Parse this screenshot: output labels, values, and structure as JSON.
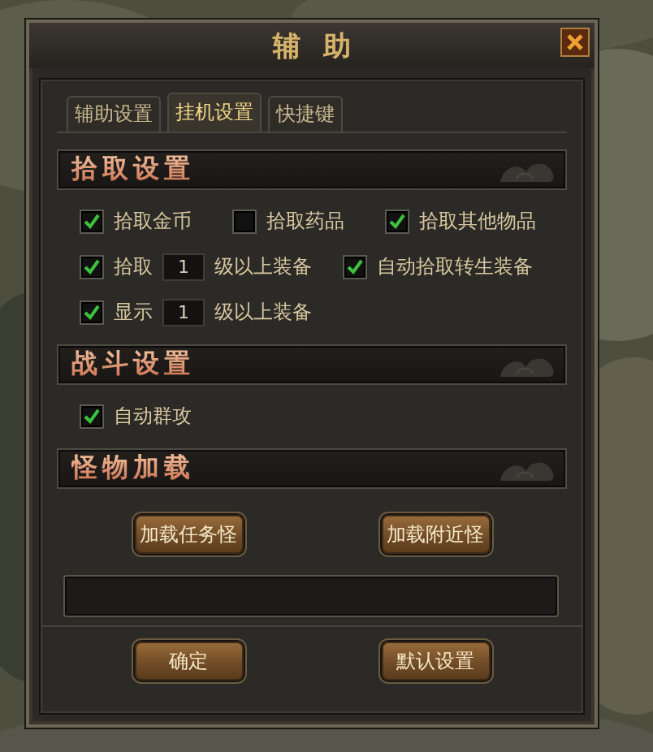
{
  "window": {
    "title": "辅助"
  },
  "tabs": [
    {
      "label": "辅助设置",
      "selected": false
    },
    {
      "label": "挂机设置",
      "selected": true
    },
    {
      "label": "快捷键",
      "selected": false
    }
  ],
  "sections": [
    {
      "title": "拾取设置",
      "lines": [
        {
          "options": [
            {
              "kind": "checkbox",
              "label": "拾取金币",
              "checked": true
            },
            {
              "kind": "checkbox",
              "label": "拾取药品",
              "checked": false
            },
            {
              "kind": "checkbox",
              "label": "拾取其他物品",
              "checked": true
            }
          ]
        },
        {
          "options": [
            {
              "kind": "level",
              "label": "拾取",
              "value": "1",
              "suffix": "级以上装备",
              "checked": true
            },
            {
              "kind": "checkbox",
              "label": "自动拾取转生装备",
              "checked": true
            }
          ]
        },
        {
          "options": [
            {
              "kind": "level",
              "label": "显示",
              "value": "1",
              "suffix": "级以上装备",
              "checked": true
            }
          ]
        }
      ]
    },
    {
      "title": "战斗设置",
      "lines": [
        {
          "options": [
            {
              "kind": "checkbox",
              "label": "自动群攻",
              "checked": true
            }
          ]
        }
      ]
    },
    {
      "title": "怪物加载",
      "buttons": [
        "加载任务怪",
        "加载附近怪"
      ]
    }
  ],
  "footer_buttons": [
    "确定",
    "默认设置"
  ]
}
